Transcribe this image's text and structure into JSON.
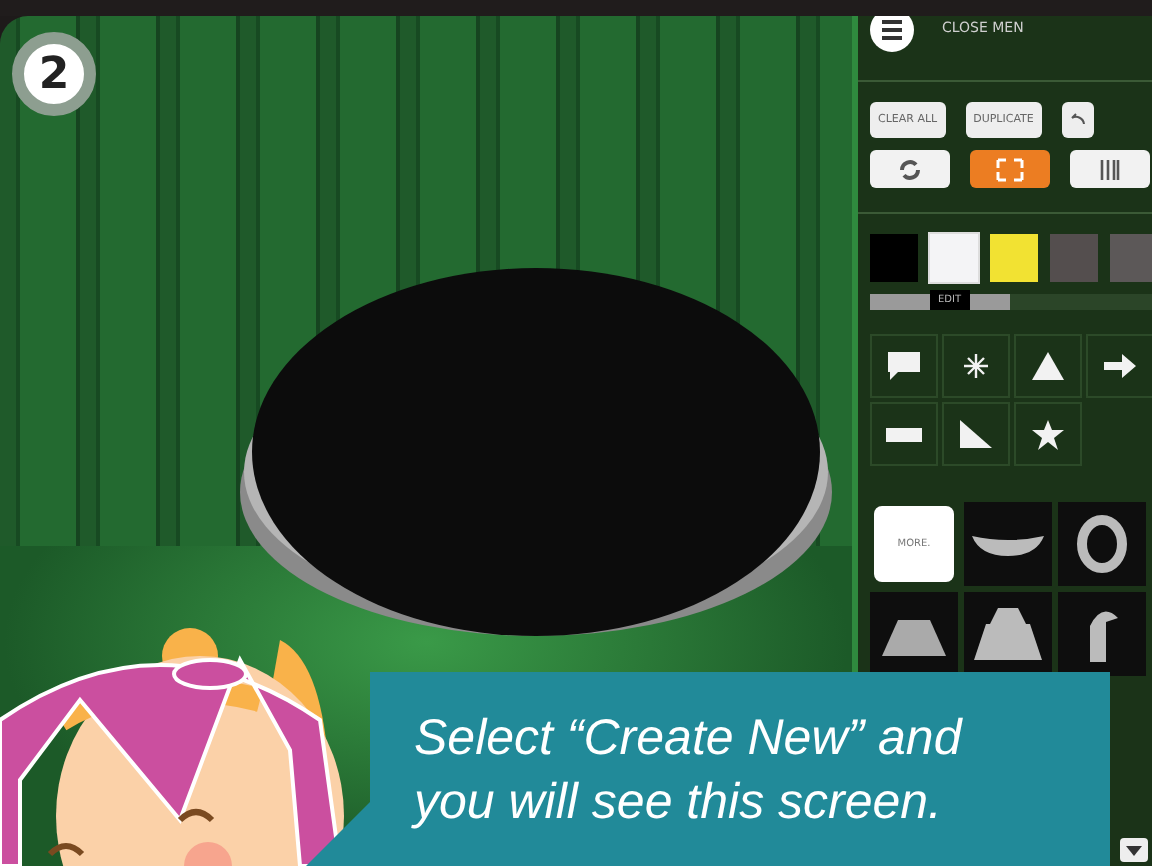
{
  "step_badge": "2",
  "panel": {
    "menu_label": "CLOSE MEN",
    "actions": [
      "CLEAR ALL",
      "DUPLICATE"
    ],
    "tools": [
      {
        "kind": "rotate",
        "selected": false
      },
      {
        "kind": "move",
        "selected": true
      },
      {
        "kind": "scale",
        "selected": false
      }
    ],
    "swatches": [
      {
        "color": "#000000",
        "selected": false
      },
      {
        "color": "#f4f4f6",
        "selected": true
      },
      {
        "color": "#f2e232"
      },
      {
        "color": "#544e4e"
      },
      {
        "color": "#5c5858"
      }
    ],
    "swatch_tooltip": "EDIT",
    "shapes": [
      {
        "kind": "speech"
      },
      {
        "kind": "burst"
      },
      {
        "kind": "triangle"
      },
      {
        "kind": "arrow"
      },
      {
        "kind": "bar"
      },
      {
        "kind": "wedge"
      },
      {
        "kind": "star"
      }
    ],
    "models": [
      {
        "kind": "more",
        "label": "MORE."
      },
      {
        "kind": "dish"
      },
      {
        "kind": "ring"
      },
      {
        "kind": "cone"
      },
      {
        "kind": "tiers"
      },
      {
        "kind": "hook"
      }
    ]
  },
  "callout": "Select “Create New” and you will see this screen."
}
